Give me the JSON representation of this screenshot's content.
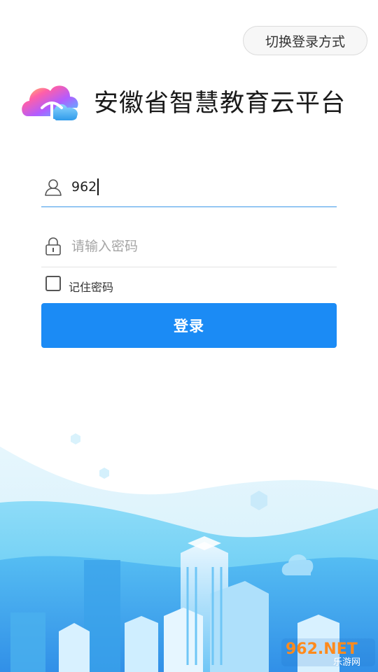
{
  "header": {
    "switch_login_label": "切换登录方式"
  },
  "brand": {
    "title": "安徽省智慧教育云平台"
  },
  "form": {
    "username_value": "962",
    "password_placeholder": "请输入密码",
    "remember_label": "记住密码",
    "remember_checked": false,
    "login_label": "登录"
  },
  "watermark": {
    "text_main": "962.NET",
    "text_sub": "乐游网"
  },
  "colors": {
    "primary": "#1b8bf5",
    "underline_active": "#3b98e8",
    "sky_light": "#d9f0fc",
    "sky_mid": "#5cc7f1",
    "sky_deep": "#2a8de8"
  },
  "icons": {
    "user": "user-icon",
    "lock": "lock-icon",
    "logo": "cloud-logo-icon"
  }
}
